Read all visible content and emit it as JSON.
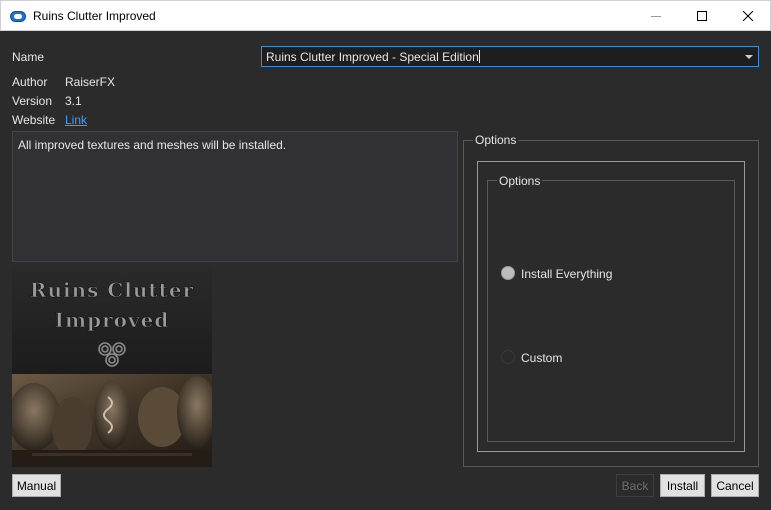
{
  "window": {
    "title": "Ruins Clutter Improved",
    "icon": "cloud-icon",
    "accent_color": "#3c8fd6"
  },
  "fields": {
    "name_label": "Name",
    "name_value": "Ruins Clutter Improved - Special Edition",
    "author_label": "Author",
    "author_value": "RaiserFX",
    "version_label": "Version",
    "version_value": "3.1",
    "website_label": "Website",
    "website_value": "Link"
  },
  "description": "All improved textures and meshes will be installed.",
  "banner": {
    "line1": "Ruins Clutter",
    "line2": "Improved"
  },
  "options": {
    "outer_title": "Options",
    "inner_title": "Options",
    "items": [
      {
        "label": "Install Everything",
        "selected": true
      },
      {
        "label": "Custom",
        "selected": false
      }
    ]
  },
  "buttons": {
    "manual": "Manual",
    "back": "Back",
    "install": "Install",
    "cancel": "Cancel"
  }
}
